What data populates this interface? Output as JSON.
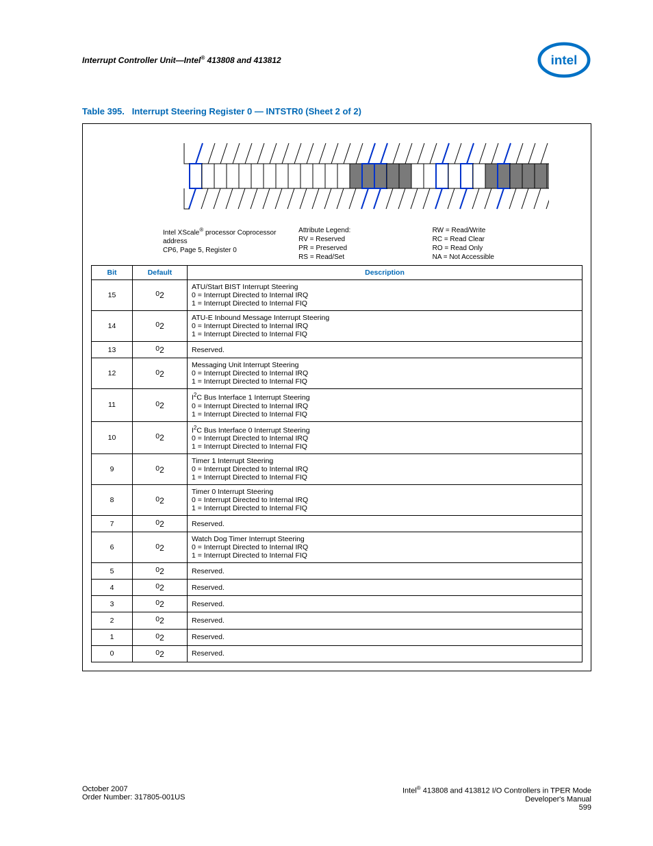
{
  "header": {
    "title_prefix": "Interrupt Controller Unit—Intel",
    "title_suffix": " 413808 and 413812"
  },
  "caption": {
    "label": "Table 395.",
    "text": "Interrupt Steering Register 0 — INTSTR0 (Sheet 2 of 2)"
  },
  "diagram_labels": {
    "left": {
      "l1_pre": "Intel XScale",
      "l1_post": " processor Coprocessor",
      "l2": "address",
      "l3": "CP6, Page 5, Register 0"
    },
    "mid": {
      "title": "Attribute Legend:",
      "rv": "RV = Reserved",
      "pr": "PR = Preserved",
      "rs": "RS = Read/Set"
    },
    "right": {
      "rw": "RW = Read/Write",
      "rc": "RC = Read Clear",
      "ro": "RO = Read Only",
      "na": "NA = Not Accessible"
    }
  },
  "table": {
    "headers": {
      "bit": "Bit",
      "def": "Default",
      "desc": "Description"
    },
    "rows": [
      {
        "bit": "15",
        "def": "0",
        "desc": [
          "ATU/Start BIST Interrupt Steering",
          "0 =  Interrupt Directed to Internal IRQ",
          "1 =  Interrupt Directed to Internal FIQ"
        ]
      },
      {
        "bit": "14",
        "def": "0",
        "desc": [
          "ATU-E Inbound Message Interrupt Steering",
          "0 =  Interrupt Directed to Internal IRQ",
          "1 =  Interrupt Directed to Internal FIQ"
        ]
      },
      {
        "bit": "13",
        "def": "0",
        "desc": [
          "Reserved."
        ]
      },
      {
        "bit": "12",
        "def": "0",
        "desc": [
          "Messaging Unit Interrupt Steering",
          "0 =  Interrupt Directed to Internal IRQ",
          "1 =  Interrupt Directed to Internal FIQ"
        ]
      },
      {
        "bit": "11",
        "def": "0",
        "i2c": true,
        "desc": [
          "C Bus Interface 1 Interrupt Steering",
          "0 =  Interrupt Directed to Internal IRQ",
          "1 =  Interrupt Directed to Internal FIQ"
        ]
      },
      {
        "bit": "10",
        "def": "0",
        "i2c": true,
        "desc": [
          "C Bus Interface 0 Interrupt Steering",
          "0 =  Interrupt Directed to Internal IRQ",
          "1 =  Interrupt Directed to Internal FIQ"
        ]
      },
      {
        "bit": "9",
        "def": "0",
        "desc": [
          "Timer 1 Interrupt Steering",
          "0 =  Interrupt Directed to Internal IRQ",
          "1 =  Interrupt Directed to Internal FIQ"
        ]
      },
      {
        "bit": "8",
        "def": "0",
        "desc": [
          "Timer 0 Interrupt Steering",
          "0 =  Interrupt Directed to Internal IRQ",
          "1 =  Interrupt Directed to Internal FIQ"
        ]
      },
      {
        "bit": "7",
        "def": "0",
        "desc": [
          "Reserved."
        ]
      },
      {
        "bit": "6",
        "def": "0",
        "desc": [
          "Watch Dog Timer Interrupt Steering",
          "0 =  Interrupt Directed to Internal IRQ",
          "1 =  Interrupt Directed to Internal FIQ"
        ]
      },
      {
        "bit": "5",
        "def": "0",
        "desc": [
          "Reserved."
        ]
      },
      {
        "bit": "4",
        "def": "0",
        "desc": [
          "Reserved."
        ]
      },
      {
        "bit": "3",
        "def": "0",
        "desc": [
          "Reserved."
        ]
      },
      {
        "bit": "2",
        "def": "0",
        "desc": [
          "Reserved."
        ]
      },
      {
        "bit": "1",
        "def": "0",
        "desc": [
          "Reserved."
        ]
      },
      {
        "bit": "0",
        "def": "0",
        "desc": [
          "Reserved."
        ]
      }
    ]
  },
  "bit_diagram": {
    "num_bits": 32,
    "shaded_ranges": [
      [
        13,
        18
      ],
      [
        24,
        26
      ],
      [
        26,
        32
      ]
    ],
    "blue_bits": [
      0,
      14,
      15,
      20,
      22,
      25,
      31
    ]
  },
  "footer": {
    "left1": "October 2007",
    "left2": "Order Number: 317805-001US",
    "right1_pre": "Intel",
    "right1_post": " 413808 and 413812 I/O Controllers in TPER Mode",
    "right2": "Developer's Manual",
    "right3": "599"
  }
}
